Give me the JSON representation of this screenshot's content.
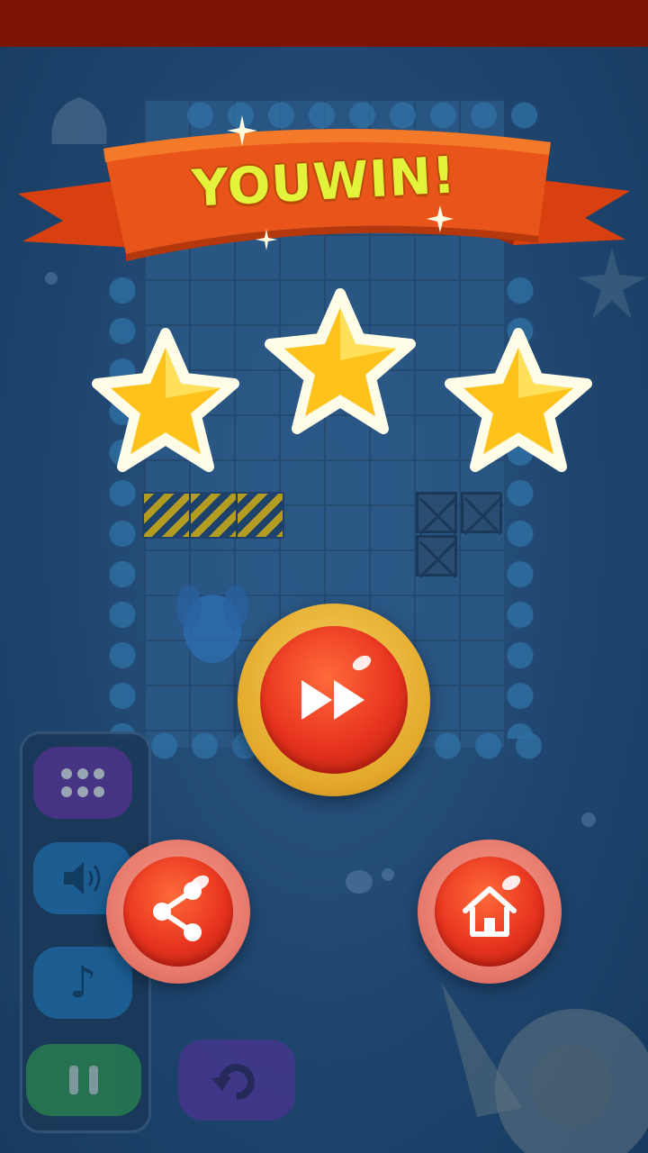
{
  "banner": {
    "title": "YOUWIN!"
  },
  "stars": {
    "earned": 3,
    "total": 3
  },
  "buttons": {
    "next": "next-level",
    "share": "share",
    "home": "home"
  },
  "side_controls": [
    "menu",
    "sound",
    "music",
    "pause"
  ],
  "icons": {
    "next": "fast-forward-icon",
    "share": "share-icon",
    "home": "home-icon",
    "menu": "grid-dots-icon",
    "sound": "speaker-icon",
    "music": "music-note-icon",
    "pause": "pause-icon",
    "restart": "restart-icon"
  },
  "colors": {
    "banner": "#e8541a",
    "title": "#e3f23a",
    "button_red": "#e8341f",
    "button_gold": "#e3a82a",
    "star": "#ffd21f",
    "top_bar": "#7d1507"
  }
}
